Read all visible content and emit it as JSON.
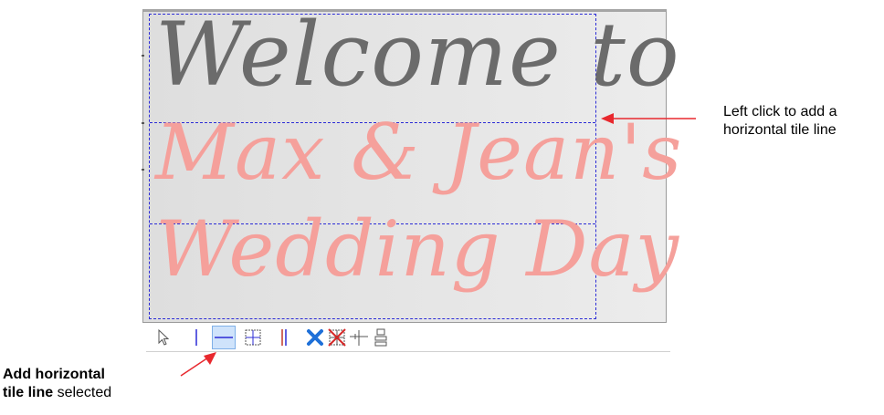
{
  "design": {
    "line1": "Welcome to",
    "line2": "Max & Jean's",
    "line3": "Wedding Day",
    "color_line1": "#6b6b6b",
    "color_pink": "#f5a09b"
  },
  "toolbar": {
    "tools": [
      {
        "name": "select-arrow-icon",
        "selected": false
      },
      {
        "name": "add-vertical-tile-line-icon",
        "selected": false
      },
      {
        "name": "add-horizontal-tile-line-icon",
        "selected": true
      },
      {
        "name": "tile-grid-icon",
        "selected": false
      },
      {
        "name": "double-vertical-line-icon",
        "selected": false
      },
      {
        "name": "delete-x-icon",
        "selected": false
      },
      {
        "name": "delete-all-tile-lines-icon",
        "selected": false
      },
      {
        "name": "split-cross-icon",
        "selected": false
      },
      {
        "name": "tile-stack-icon",
        "selected": false
      }
    ]
  },
  "annotations": {
    "right_line1": "Left click to add a",
    "right_line2": "horizontal tile line",
    "left_bold1": "Add horizontal",
    "left_bold2": "tile line",
    "left_normal": " selected"
  },
  "colors": {
    "arrow": "#e8282e",
    "tile_line": "#2b2bd6",
    "selected_tool_bg": "#cfe3fb"
  }
}
